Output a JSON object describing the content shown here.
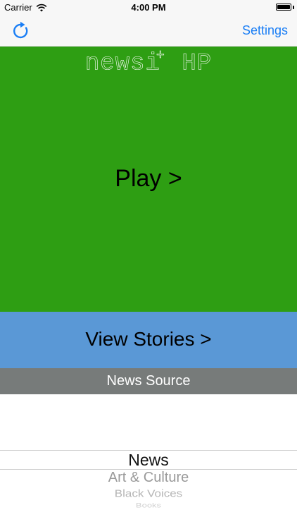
{
  "status_bar": {
    "carrier": "Carrier",
    "time": "4:00 PM",
    "icons": [
      "wifi-icon",
      "battery-icon"
    ]
  },
  "nav_bar": {
    "refresh_icon": "refresh-icon",
    "settings_label": "Settings",
    "accent_color": "#1a7ef5"
  },
  "app": {
    "title": "newsi",
    "title_superscript": "+",
    "title_suffix": "HP"
  },
  "play": {
    "label": "Play >",
    "background": "#2e9e13"
  },
  "view_stories": {
    "label": "View Stories >",
    "background": "#5a98d6"
  },
  "news_source": {
    "header": "News Source",
    "options": [
      "News",
      "Art & Culture",
      "Black Voices",
      "Books"
    ],
    "selected": "News"
  }
}
